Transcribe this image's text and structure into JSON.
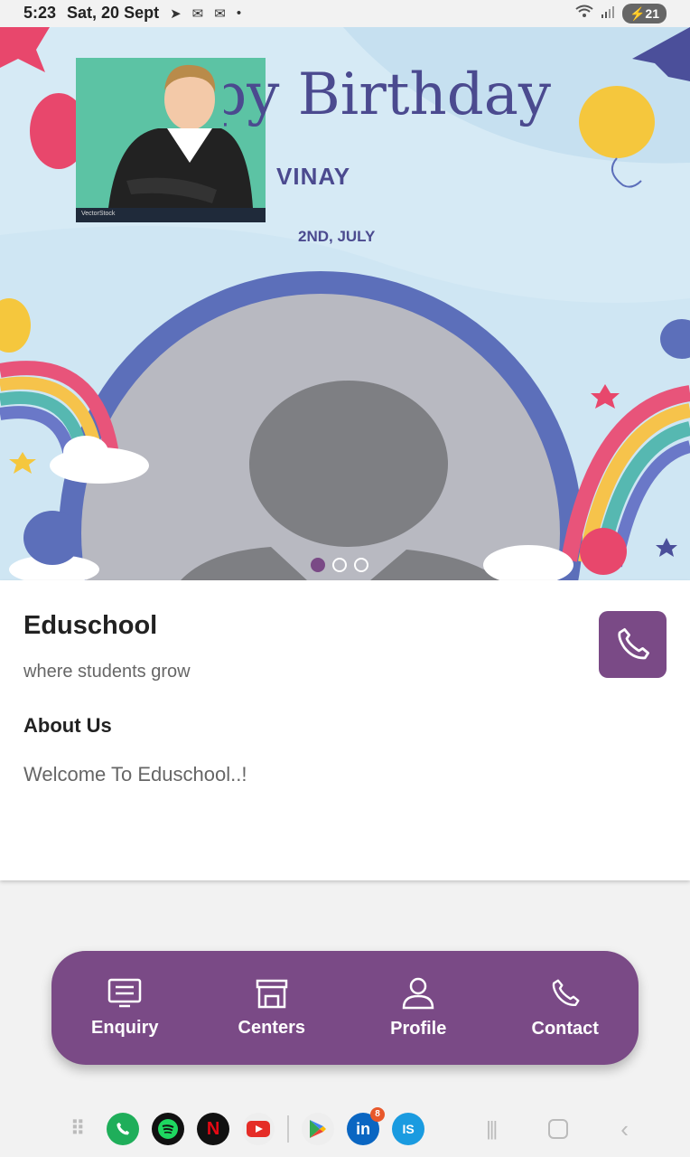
{
  "status_bar": {
    "time": "5:23",
    "date": "Sat, 20 Sept",
    "notification_icons": [
      "telegram-icon",
      "message-icon",
      "message-icon",
      "dot-icon"
    ],
    "battery": "21"
  },
  "banner": {
    "heading": "Happy Birthday",
    "name": "VINAY",
    "date": "2ND, JULY",
    "watermark": "VectorStock",
    "slides_count": 3,
    "active_slide": 1
  },
  "school": {
    "name": "Eduschool",
    "tagline": "where students grow",
    "about_title": "About Us",
    "about_text": "Welcome To Eduschool..!"
  },
  "bottom_nav": {
    "items": [
      {
        "label": "Enquiry",
        "icon": "monitor-list-icon"
      },
      {
        "label": "Centers",
        "icon": "store-icon"
      },
      {
        "label": "Profile",
        "icon": "user-icon"
      },
      {
        "label": "Contact",
        "icon": "phone-icon"
      }
    ]
  },
  "dock": {
    "apps": [
      {
        "name": "app-drawer",
        "icon": "grid-icon"
      },
      {
        "name": "phone",
        "icon": "phone-icon"
      },
      {
        "name": "spotify",
        "icon": "spotify-icon"
      },
      {
        "name": "netflix",
        "icon": "netflix-icon",
        "glyph": "N"
      },
      {
        "name": "youtube",
        "icon": "youtube-icon"
      },
      {
        "name": "play-store",
        "icon": "play-store-icon"
      },
      {
        "name": "linkedin",
        "icon": "linkedin-icon",
        "glyph": "in",
        "badge": "8"
      },
      {
        "name": "is-app",
        "icon": "is-icon",
        "glyph": "IS"
      }
    ]
  },
  "colors": {
    "primary": "#7a4a86",
    "banner_bg": "#d6eaf5"
  }
}
